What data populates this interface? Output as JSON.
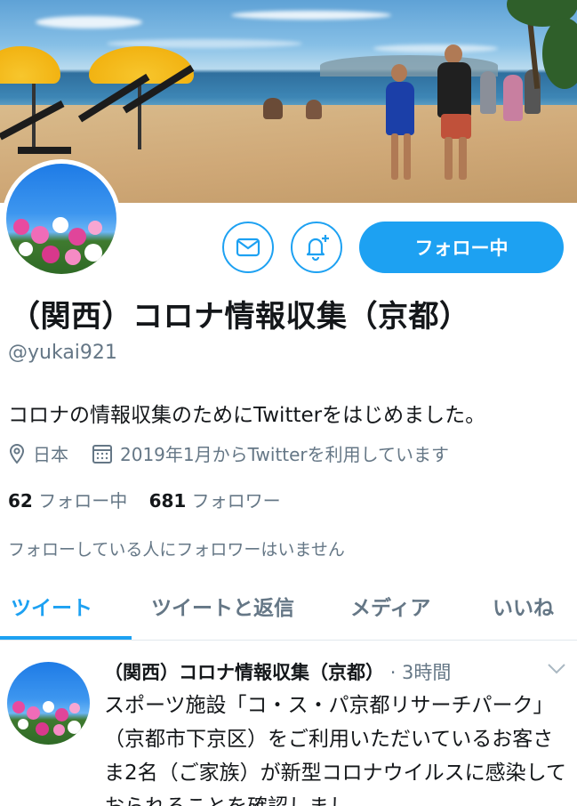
{
  "profile": {
    "name": "（関西）コロナ情報収集（京都）",
    "handle": "@yukai921",
    "bio": "コロナの情報収集のためにTwitterをはじめました。",
    "location": "日本",
    "joined": "2019年1月からTwitterを利用しています",
    "following_count": "62",
    "following_label": "フォロー中",
    "followers_count": "681",
    "followers_label": "フォロワー",
    "followers_you_know": "フォローしている人にフォロワーはいません"
  },
  "actions": {
    "follow_button": "フォロー中",
    "message_icon": "mail-icon",
    "notify_icon": "bell-plus-icon"
  },
  "tabs": [
    {
      "label": "ツイート",
      "active": true
    },
    {
      "label": "ツイートと返信",
      "active": false
    },
    {
      "label": "メディア",
      "active": false
    },
    {
      "label": "いいね",
      "active": false
    }
  ],
  "tweet": {
    "name": "（関西）コロナ情報収集（京都）",
    "time": "· 3時間",
    "text": "スポーツ施設「コ・ス・パ京都リサーチパーク」（京都市下京区）をご利用いただいているお客さま2名（ご家族）が新型コロナウイルスに感染しておられることを確認しまし"
  },
  "colors": {
    "accent": "#1da1f2",
    "secondary_text": "#657786",
    "primary_text": "#14171a",
    "divider": "#e1e8ed"
  }
}
